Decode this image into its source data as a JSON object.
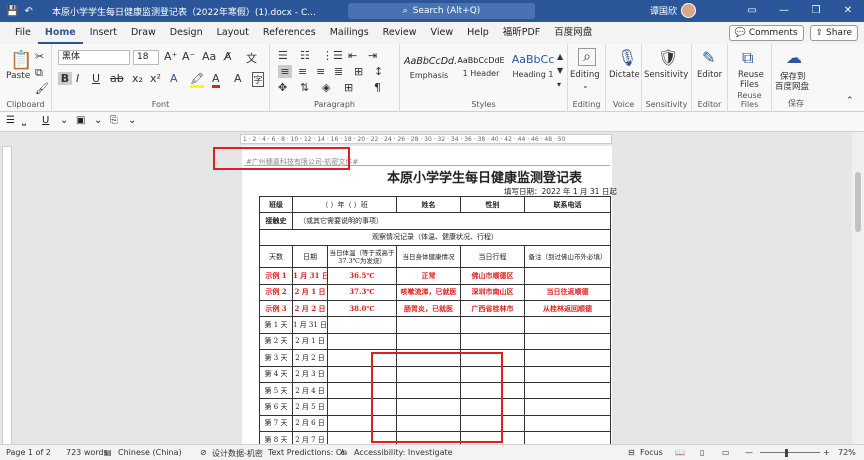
{
  "titlebar": {
    "doc_title": "本原小学学生每日健康监测登记表（2022年寒假）(1).docx - C...",
    "search_placeholder": "Search (Alt+Q)",
    "user_name": "谭国欣"
  },
  "tabs": [
    "File",
    "Home",
    "Insert",
    "Draw",
    "Design",
    "Layout",
    "References",
    "Mailings",
    "Review",
    "View",
    "Help",
    "福昕PDF",
    "百度网盘"
  ],
  "tabs_right": {
    "comments": "Comments",
    "share": "Share"
  },
  "ribbon": {
    "clipboard": {
      "paste": "Paste",
      "label": "Clipboard"
    },
    "font": {
      "family": "黑体",
      "size": "18",
      "label": "Font"
    },
    "paragraph": {
      "label": "Paragraph"
    },
    "styles": {
      "label": "Styles",
      "items": [
        {
          "preview": "AaBbCcDd.",
          "name": "Emphasis"
        },
        {
          "preview": "AaBbCcDdE",
          "name": "1 Header"
        },
        {
          "preview": "AaBbCc",
          "name": "Heading 1"
        }
      ]
    },
    "editing": {
      "label": "Editing"
    },
    "voice": {
      "dictate": "Dictate",
      "label": "Voice"
    },
    "sensitivity": {
      "name": "Sensitivity",
      "label": "Sensitivity"
    },
    "editor": {
      "name": "Editor",
      "label": "Editor"
    },
    "reuse": {
      "name1": "Reuse",
      "name2": "Files",
      "label": "Reuse Files"
    },
    "save": {
      "name1": "保存到",
      "name2": "百度网盘",
      "label": "保存"
    }
  },
  "document": {
    "header_text": "#广州穗嘉科技有限公司-机密文件#",
    "title": "本原小学学生每日健康监测登记表",
    "fill_date": "填写日期：2022 年 1 月 31 日起",
    "row1": {
      "class_label": "班级",
      "class_value": "（    ）年（    ）班",
      "name_label": "姓名",
      "sex_label": "性别",
      "phone_label": "联系电话"
    },
    "row2": {
      "label": "接触史",
      "value": "（或其它需要说明的事项）"
    },
    "observation": "观察情况记录（体温、健康状况、行程）",
    "headers": [
      "天数",
      "日期",
      "当日体温（等于或高于 37.3℃为发烧）",
      "当日身体健康情况",
      "当日行程",
      "备注（到过佛山市外必填）"
    ],
    "examples": [
      {
        "day": "示例 1",
        "date": "1 月 31 日",
        "temp": "36.5℃",
        "health": "正常",
        "trip": "佛山市顺德区",
        "note": ""
      },
      {
        "day": "示例 2",
        "date": "2 月 1 日",
        "temp": "37.3℃",
        "health": "咳嗽流涕，已就医",
        "trip": "深圳市南山区",
        "note": "当日往返顺德"
      },
      {
        "day": "示例 3",
        "date": "2 月 2 日",
        "temp": "38.0℃",
        "health": "肠胃炎，已就医",
        "trip": "广西省桂林市",
        "note": "从桂林返回顺德"
      }
    ],
    "days": [
      {
        "day": "第 1 天",
        "date": "1 月 31 日"
      },
      {
        "day": "第 2 天",
        "date": "2 月 1 日"
      },
      {
        "day": "第 3 天",
        "date": "2 月 2 日"
      },
      {
        "day": "第 4 天",
        "date": "2 月 3 日"
      },
      {
        "day": "第 5 天",
        "date": "2 月 4 日"
      },
      {
        "day": "第 6 天",
        "date": "2 月 5 日"
      },
      {
        "day": "第 7 天",
        "date": "2 月 6 日"
      },
      {
        "day": "第 8 天",
        "date": "2 月 7 日"
      }
    ]
  },
  "status": {
    "page": "Page 1 of 2",
    "words": "723 words",
    "language": "Chinese (China)",
    "design": "设计数据-机密",
    "predictions": "Text Predictions: On",
    "accessibility": "Accessibility: Investigate",
    "focus": "Focus",
    "zoom": "72%"
  }
}
